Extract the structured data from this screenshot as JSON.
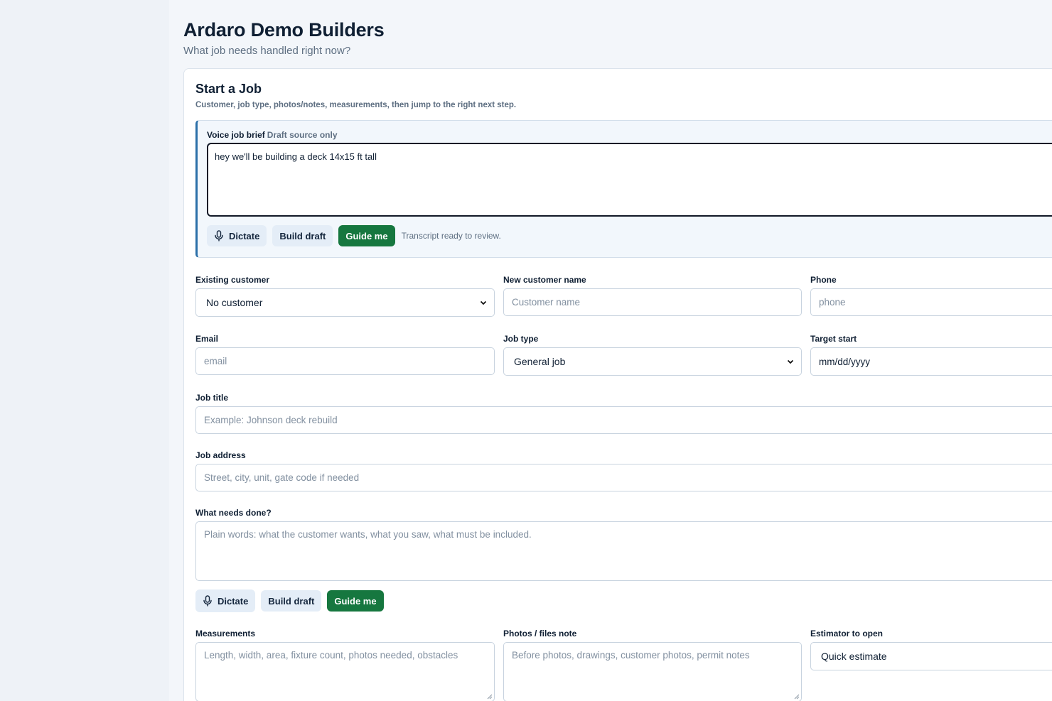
{
  "header": {
    "title": "Ardaro Demo Builders",
    "subtitle": "What job needs handled right now?"
  },
  "card": {
    "title": "Start a Job",
    "subtitle": "Customer, job type, photos/notes, measurements, then jump to the right next step."
  },
  "voice": {
    "label": "Voice job brief",
    "label_note": "Draft source only",
    "transcript": "hey we'll be building a deck 14x15 ft tall",
    "dictate_label": "Dictate",
    "build_draft_label": "Build draft",
    "guide_label": "Guide me",
    "status": "Transcript ready to review."
  },
  "fields": {
    "existing_customer": {
      "label": "Existing customer",
      "value": "No customer"
    },
    "new_customer_name": {
      "label": "New customer name",
      "placeholder": "Customer name"
    },
    "phone": {
      "label": "Phone",
      "placeholder": "phone"
    },
    "email": {
      "label": "Email",
      "placeholder": "email"
    },
    "job_type": {
      "label": "Job type",
      "value": "General job"
    },
    "target_start": {
      "label": "Target start",
      "value": "mm/dd/yyyy"
    },
    "job_title": {
      "label": "Job title",
      "placeholder": "Example: Johnson deck rebuild"
    },
    "job_address": {
      "label": "Job address",
      "placeholder": "Street, city, unit, gate code if needed"
    },
    "needs_done": {
      "label": "What needs done?",
      "placeholder": "Plain words: what the customer wants, what you saw, what must be included."
    },
    "measurements": {
      "label": "Measurements",
      "placeholder": "Length, width, area, fixture count, photos needed, obstacles"
    },
    "photos_note": {
      "label": "Photos / files note",
      "placeholder": "Before photos, drawings, customer photos, permit notes"
    },
    "estimator": {
      "label": "Estimator to open",
      "value": "Quick estimate"
    }
  },
  "needs_actions": {
    "dictate_label": "Dictate",
    "build_draft_label": "Build draft",
    "guide_label": "Guide me"
  },
  "colors": {
    "primary_green": "#16773f",
    "accent_blue": "#2a6fa8",
    "soft_button": "#e4edf7"
  },
  "icons": {
    "mic": "microphone-icon",
    "chevron": "chevron-down-icon"
  }
}
